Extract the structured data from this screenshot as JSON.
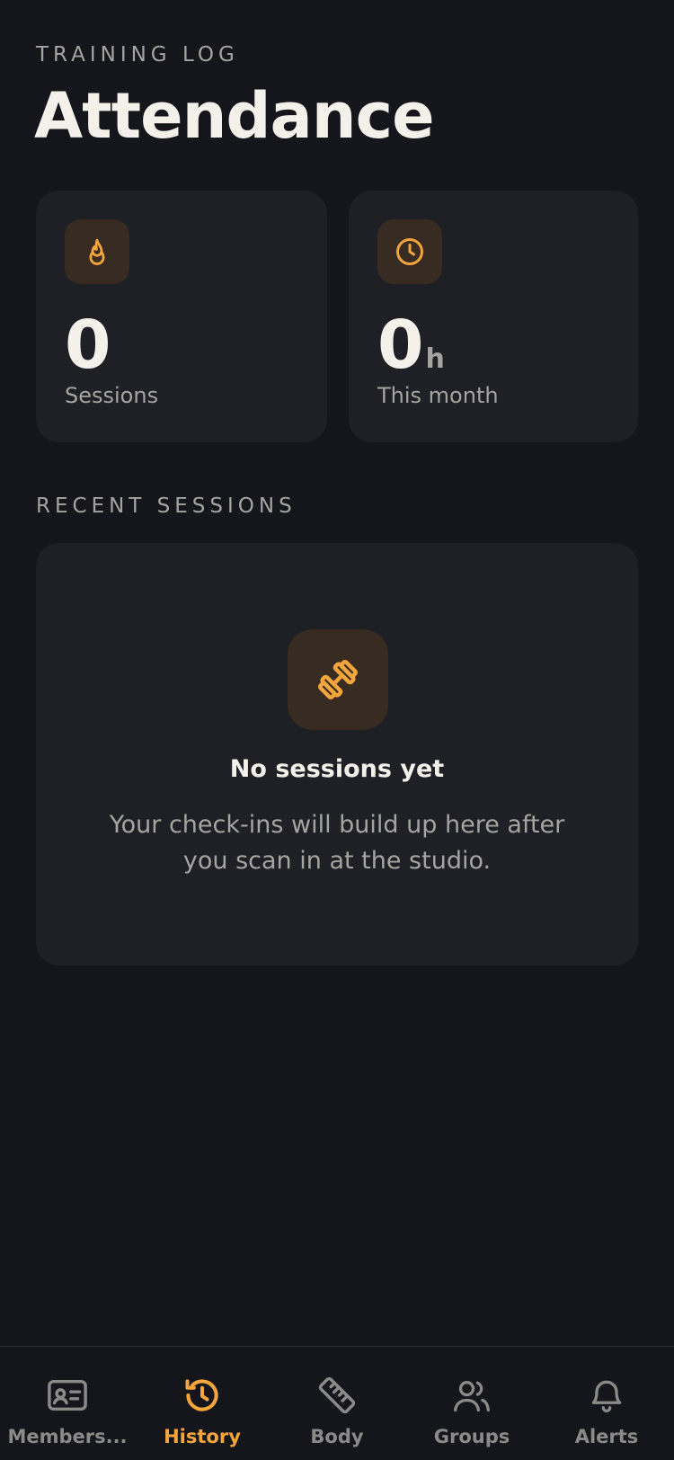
{
  "header": {
    "eyebrow": "TRAINING LOG",
    "title": "Attendance"
  },
  "stats": [
    {
      "value": "0",
      "unit": "",
      "label": "Sessions",
      "icon": "flame-icon"
    },
    {
      "value": "0",
      "unit": "h",
      "label": "This month",
      "icon": "clock-icon"
    }
  ],
  "recent": {
    "section_label": "RECENT SESSIONS",
    "empty_title": "No sessions yet",
    "empty_text": "Your check-ins will build up here after you scan in at the studio.",
    "empty_icon": "dumbbell-icon"
  },
  "tabs": [
    {
      "label": "Members...",
      "icon": "id-card-icon",
      "active": false
    },
    {
      "label": "History",
      "icon": "history-icon",
      "active": true
    },
    {
      "label": "Body",
      "icon": "ruler-icon",
      "active": false
    },
    {
      "label": "Groups",
      "icon": "users-icon",
      "active": false
    },
    {
      "label": "Alerts",
      "icon": "bell-icon",
      "active": false
    }
  ],
  "colors": {
    "background": "#15161b",
    "card": "#1f2025",
    "accent": "#f4a53b",
    "muted": "#a6a4a0",
    "text": "#f4f1ea"
  }
}
